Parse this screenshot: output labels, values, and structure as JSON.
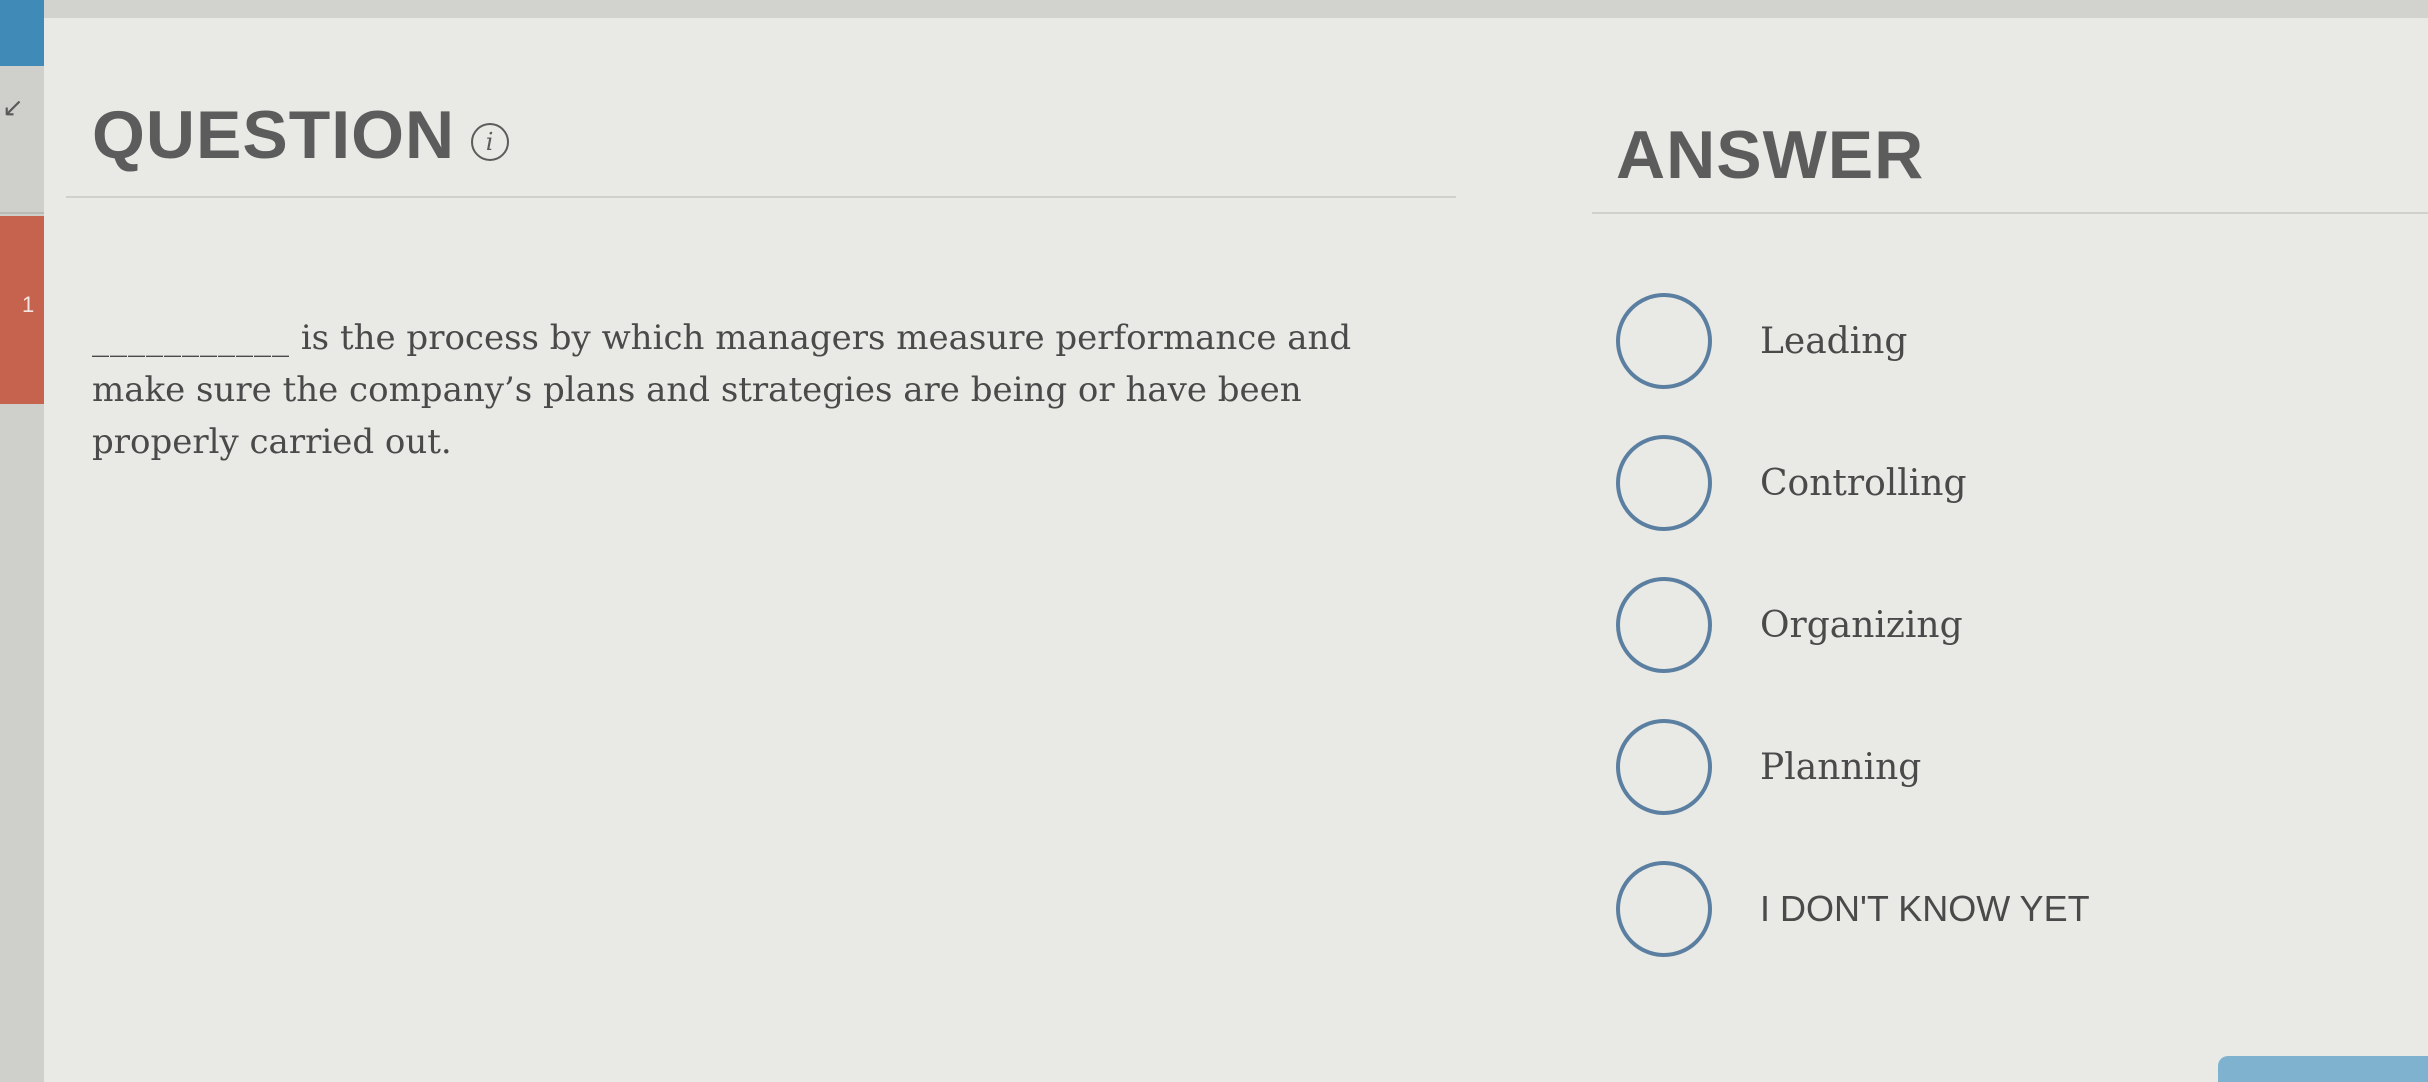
{
  "sidebar": {
    "question_number": "1",
    "arrow_glyph": "↙"
  },
  "question": {
    "heading": "QUESTION",
    "info_glyph": "i",
    "blank": "___________",
    "text": "is the process by which managers measure performance and make sure the company’s plans and strategies are being or have been properly carried out."
  },
  "answer": {
    "heading": "ANSWER",
    "options": [
      {
        "label": "Leading"
      },
      {
        "label": "Controlling"
      },
      {
        "label": "Organizing"
      },
      {
        "label": "Planning"
      },
      {
        "label": "I DON'T KNOW YET"
      }
    ]
  },
  "colors": {
    "accent_blue": "#3f8ab7",
    "tab_red": "#c5634f",
    "radio_border": "#5b7fa0",
    "heading_gray": "#5c5c5c"
  },
  "icons": {
    "info": "info-icon",
    "arrow": "arrow-icon"
  }
}
